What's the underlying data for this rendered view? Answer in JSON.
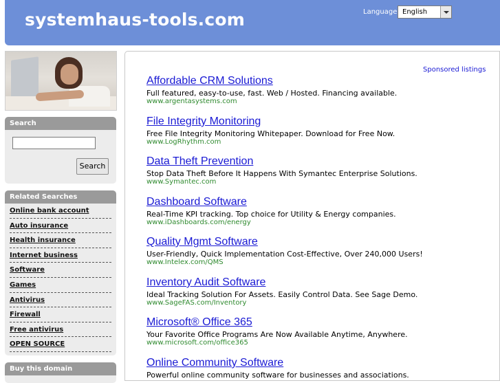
{
  "header": {
    "site_title": "systemhaus-tools.com",
    "language_label": "Language:",
    "language_value": "English"
  },
  "sidebar": {
    "search_title": "Search",
    "search_button": "Search",
    "related_title": "Related Searches",
    "related": [
      "Online bank account",
      "Auto insurance",
      "Health insurance",
      "Internet business",
      "Software",
      "Games",
      "Antivirus",
      "Firewall",
      "Free antivirus",
      "OPEN SOURCE"
    ],
    "buy_title": "Buy this domain"
  },
  "main": {
    "sponsored_label": "Sponsored listings",
    "listings": [
      {
        "title": "Affordable CRM Solutions",
        "desc": "Full featured, easy-to-use, fast. Web / Hosted. Financing available.",
        "url": "www.argentasystems.com"
      },
      {
        "title": "File Integrity Monitoring",
        "desc": "Free File Integrity Monitoring Whitepaper. Download for Free Now.",
        "url": "www.LogRhythm.com"
      },
      {
        "title": "Data Theft Prevention",
        "desc": "Stop Data Theft Before It Happens With Symantec Enterprise Solutions.",
        "url": "www.Symantec.com"
      },
      {
        "title": "Dashboard Software",
        "desc": "Real-Time KPI tracking. Top choice for Utility & Energy companies.",
        "url": "www.iDashboards.com/energy"
      },
      {
        "title": "Quality Mgmt Software",
        "desc": "User-Friendly, Quick Implementation Cost-Effective, Over 240,000 Users!",
        "url": "www.Intelex.com/QMS"
      },
      {
        "title": "Inventory Audit Software",
        "desc": "Ideal Tracking Solution For Assets. Easily Control Data. See Sage Demo.",
        "url": "www.SageFAS.com/Inventory"
      },
      {
        "title": "Microsoft® Office 365",
        "desc": "Your Favorite Office Programs Are Now Available Anytime, Anywhere.",
        "url": "www.microsoft.com/office365"
      },
      {
        "title": "Online Community Software",
        "desc": "Powerful online community software for businesses and associations.",
        "url": ""
      }
    ]
  }
}
